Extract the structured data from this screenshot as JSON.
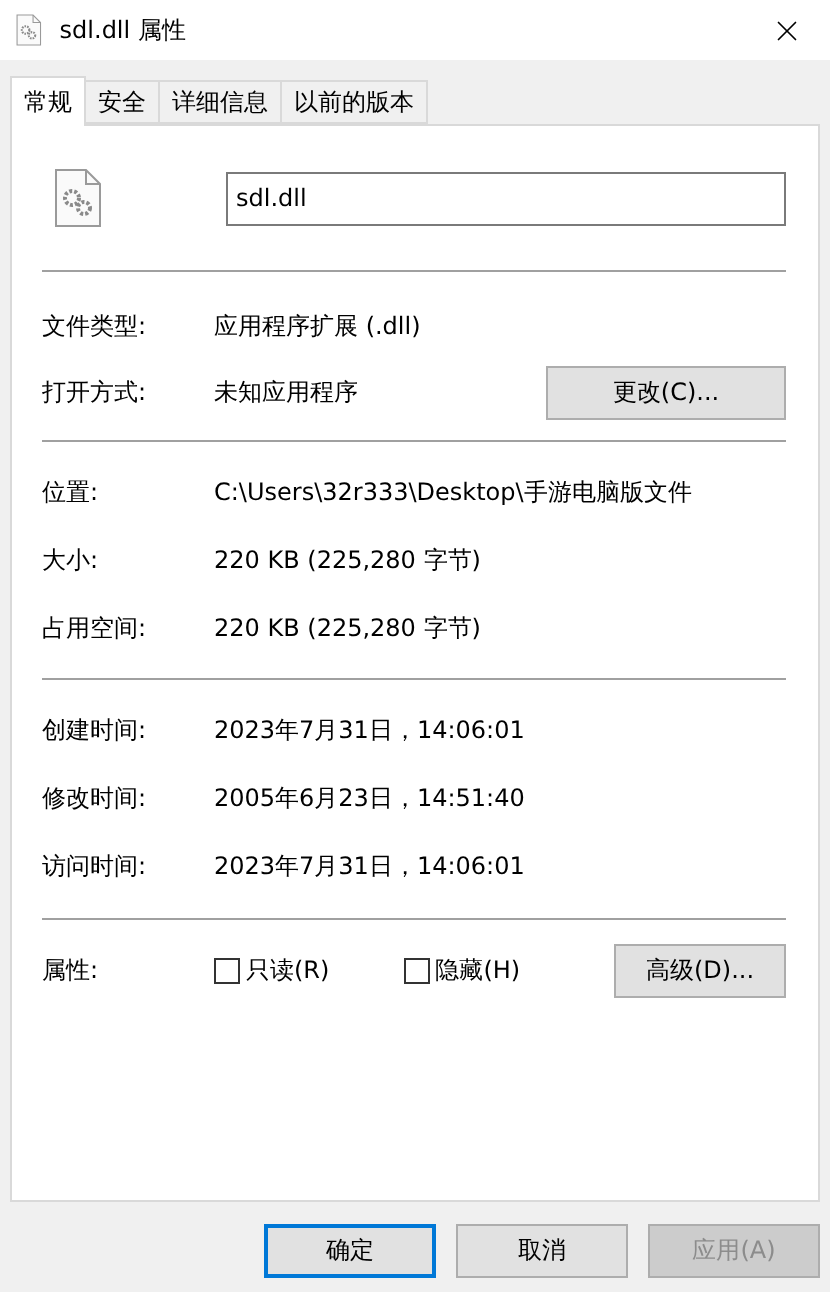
{
  "window": {
    "title": "sdl.dll 属性"
  },
  "tabs": [
    {
      "label": "常规",
      "selected": true
    },
    {
      "label": "安全",
      "selected": false
    },
    {
      "label": "详细信息",
      "selected": false
    },
    {
      "label": "以前的版本",
      "selected": false
    }
  ],
  "file_name": {
    "value": "sdl.dll"
  },
  "sections": [
    {
      "rows": [
        {
          "label": "文件类型:",
          "value": "应用程序扩展 (.dll)"
        },
        {
          "label": "打开方式:",
          "value": "未知应用程序",
          "button": "更改(C)..."
        }
      ]
    },
    {
      "rows": [
        {
          "label": "位置:",
          "value": "C:\\Users\\32r333\\Desktop\\手游电脑版文件"
        },
        {
          "label": "大小:",
          "value": "220 KB (225,280 字节)"
        },
        {
          "label": "占用空间:",
          "value": "220 KB (225,280 字节)"
        }
      ]
    },
    {
      "rows": [
        {
          "label": "创建时间:",
          "value": "2023年7月31日，14:06:01"
        },
        {
          "label": "修改时间:",
          "value": "2005年6月23日，14:51:40"
        },
        {
          "label": "访问时间:",
          "value": "2023年7月31日，14:06:01"
        }
      ]
    }
  ],
  "attributes": {
    "label": "属性:",
    "checkboxes": [
      {
        "label": "只读(R)",
        "checked": false
      },
      {
        "label": "隐藏(H)",
        "checked": false
      }
    ],
    "button": "高级(D)..."
  },
  "buttons": [
    {
      "label": "确定",
      "default": true,
      "disabled": false
    },
    {
      "label": "取消",
      "default": false,
      "disabled": false
    },
    {
      "label": "应用(A)",
      "default": false,
      "disabled": true
    }
  ]
}
